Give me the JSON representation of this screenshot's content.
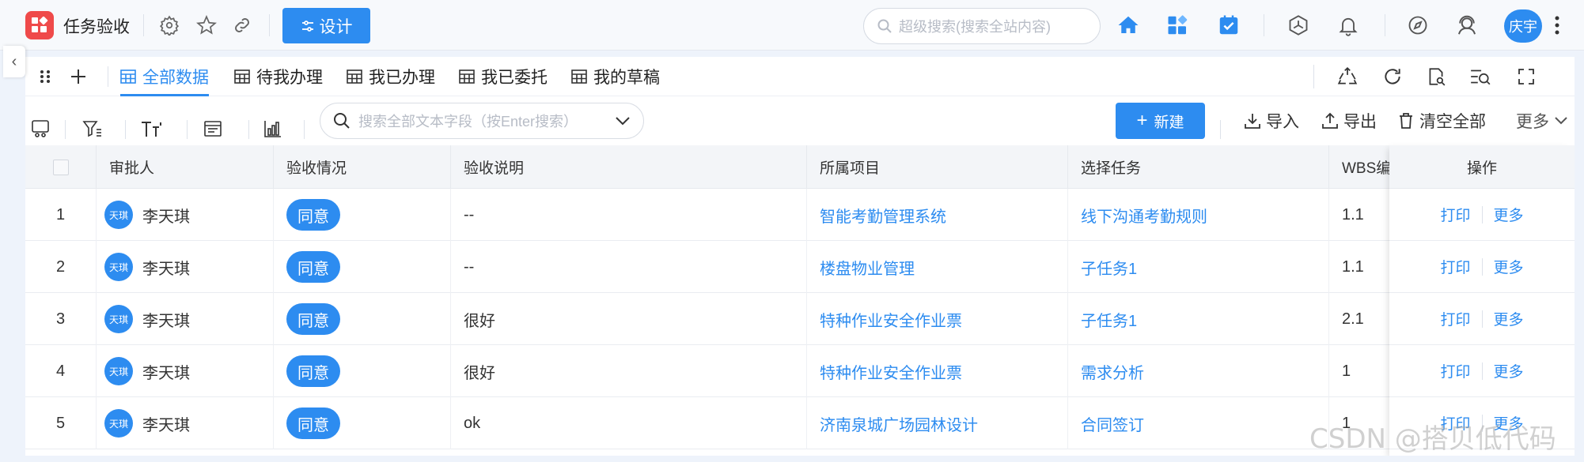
{
  "app": {
    "title": "任务验收",
    "design_label": "设计",
    "search_placeholder": "超级搜索(搜索全站内容)",
    "user_name": "庆宇"
  },
  "views": [
    "全部数据",
    "待我办理",
    "我已办理",
    "我已委托",
    "我的草稿"
  ],
  "active_view": 0,
  "toolbar": {
    "search_placeholder": "搜索全部文本字段（按Enter搜索）",
    "new_label": "新建",
    "import_label": "导入",
    "export_label": "导出",
    "clear_label": "清空全部",
    "more_label": "更多"
  },
  "table": {
    "columns": [
      "审批人",
      "验收情况",
      "验收说明",
      "所属项目",
      "选择任务",
      "WBS编",
      "操作"
    ],
    "rows": [
      {
        "no": "1",
        "approver": "李天琪",
        "avatar": "天琪",
        "status": "同意",
        "note": "--",
        "project": "智能考勤管理系统",
        "task": "线下沟通考勤规则",
        "wbs": "1.1"
      },
      {
        "no": "2",
        "approver": "李天琪",
        "avatar": "天琪",
        "status": "同意",
        "note": "--",
        "project": "楼盘物业管理",
        "task": "子任务1",
        "wbs": "1.1"
      },
      {
        "no": "3",
        "approver": "李天琪",
        "avatar": "天琪",
        "status": "同意",
        "note": "很好",
        "project": "特种作业安全作业票",
        "task": "子任务1",
        "wbs": "2.1"
      },
      {
        "no": "4",
        "approver": "李天琪",
        "avatar": "天琪",
        "status": "同意",
        "note": "很好",
        "project": "特种作业安全作业票",
        "task": "需求分析",
        "wbs": "1"
      },
      {
        "no": "5",
        "approver": "李天琪",
        "avatar": "天琪",
        "status": "同意",
        "note": "ok",
        "project": "济南泉城广场园林设计",
        "task": "合同签订",
        "wbs": "1"
      }
    ],
    "op_print": "打印",
    "op_more": "更多"
  },
  "watermark": "CSDN @搭贝低代码",
  "colors": {
    "accent": "#2d8cf0",
    "logo": "#ef4a4a"
  }
}
